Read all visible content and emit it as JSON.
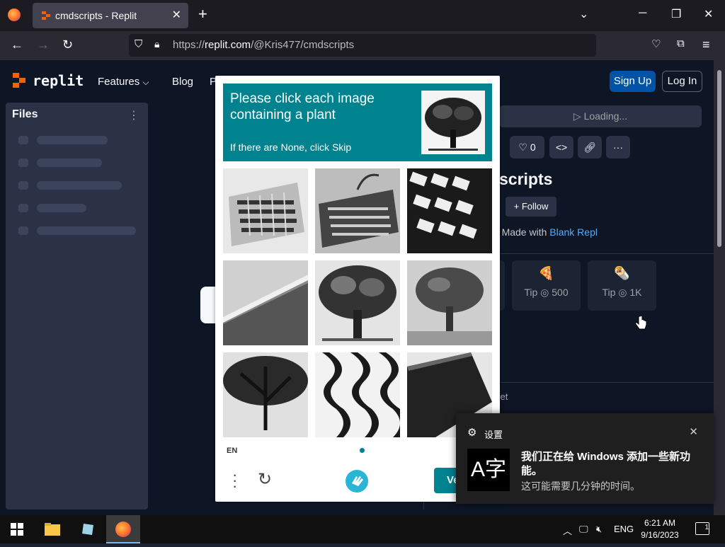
{
  "browser": {
    "tab_title": "cmdscripts - Replit",
    "tab_close": "✕",
    "new_tab": "+",
    "url_prefix": "https://",
    "url_domain": "replit.com",
    "url_path": "/@Kris477/cmdscripts"
  },
  "site": {
    "logo_text": "replit",
    "nav": [
      "Features",
      "Blog",
      "P"
    ],
    "sign_up": "Sign Up",
    "log_in": "Log In"
  },
  "files": {
    "header": "Files",
    "menu": "⋮"
  },
  "repl": {
    "loading": "Loading...",
    "like_count": "0",
    "title_fragment": "scripts",
    "follow": "Follow",
    "made_with_prefix": "Made with",
    "made_with_link": "Blank Repl",
    "tips": [
      {
        "emoji": "🍕",
        "label": "Tip ◎ 500"
      },
      {
        "emoji": "🌯",
        "label": "Tip ◎ 1K"
      }
    ],
    "comments_fragment": "yet"
  },
  "captcha": {
    "prompt": "Please click each image containing a plant",
    "sub": "If there are None, click Skip",
    "lang": "EN",
    "verify": "Ve",
    "cells": [
      "keyboard",
      "keyboard",
      "keyboard",
      "laptop",
      "tree",
      "tree",
      "tree",
      "zebra",
      "laptop"
    ]
  },
  "toast": {
    "app": "设置",
    "title": "我们正在给 Windows 添加一些新功能。",
    "body": "这可能需要几分钟的时间。",
    "icon_text": "A字"
  },
  "taskbar": {
    "lang": "ENG",
    "time": "6:21 AM",
    "date": "9/16/2023",
    "notif_count": "1"
  }
}
